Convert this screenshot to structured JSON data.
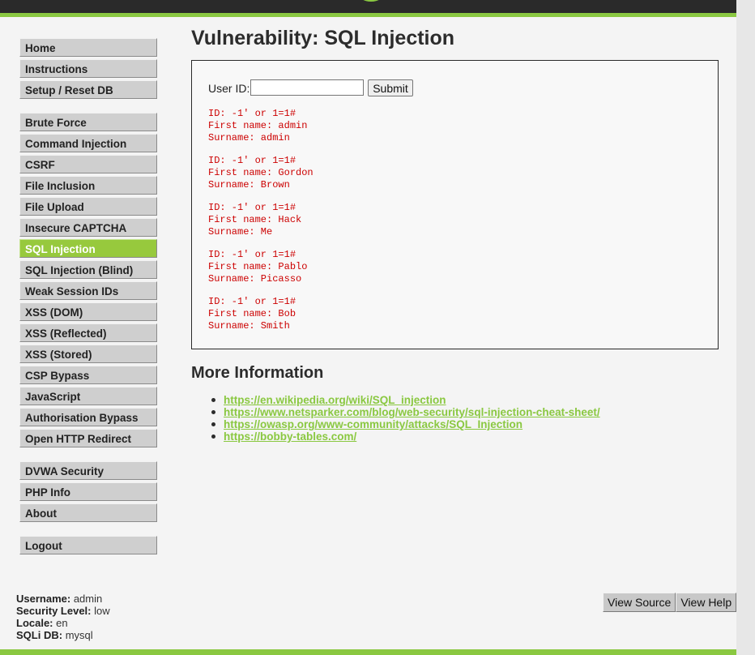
{
  "page": {
    "title": "Vulnerability: SQL Injection"
  },
  "menu": {
    "groups": [
      [
        {
          "label": "Home"
        },
        {
          "label": "Instructions"
        },
        {
          "label": "Setup / Reset DB"
        }
      ],
      [
        {
          "label": "Brute Force"
        },
        {
          "label": "Command Injection"
        },
        {
          "label": "CSRF"
        },
        {
          "label": "File Inclusion"
        },
        {
          "label": "File Upload"
        },
        {
          "label": "Insecure CAPTCHA"
        },
        {
          "label": "SQL Injection",
          "selected": true
        },
        {
          "label": "SQL Injection (Blind)"
        },
        {
          "label": "Weak Session IDs"
        },
        {
          "label": "XSS (DOM)"
        },
        {
          "label": "XSS (Reflected)"
        },
        {
          "label": "XSS (Stored)"
        },
        {
          "label": "CSP Bypass"
        },
        {
          "label": "JavaScript"
        },
        {
          "label": "Authorisation Bypass"
        },
        {
          "label": "Open HTTP Redirect"
        }
      ],
      [
        {
          "label": "DVWA Security"
        },
        {
          "label": "PHP Info"
        },
        {
          "label": "About"
        }
      ],
      [
        {
          "label": "Logout"
        }
      ]
    ]
  },
  "form": {
    "user_id_label": "User ID:",
    "user_id_value": "",
    "submit_label": "Submit"
  },
  "results": [
    {
      "id": "ID: -1' or 1=1#",
      "first_name": "First name: admin",
      "surname": "Surname: admin"
    },
    {
      "id": "ID: -1' or 1=1#",
      "first_name": "First name: Gordon",
      "surname": "Surname: Brown"
    },
    {
      "id": "ID: -1' or 1=1#",
      "first_name": "First name: Hack",
      "surname": "Surname: Me"
    },
    {
      "id": "ID: -1' or 1=1#",
      "first_name": "First name: Pablo",
      "surname": "Surname: Picasso"
    },
    {
      "id": "ID: -1' or 1=1#",
      "first_name": "First name: Bob",
      "surname": "Surname: Smith"
    }
  ],
  "more_info": {
    "title": "More Information",
    "links": [
      "https://en.wikipedia.org/wiki/SQL_injection",
      "https://www.netsparker.com/blog/web-security/sql-injection-cheat-sheet/",
      "https://owasp.org/www-community/attacks/SQL_Injection",
      "https://bobby-tables.com/"
    ]
  },
  "footer": {
    "username_label": "Username:",
    "username": "admin",
    "security_label": "Security Level:",
    "security": "low",
    "locale_label": "Locale:",
    "locale": "en",
    "sqli_db_label": "SQLi DB:",
    "sqli_db": "mysql",
    "view_source_label": "View Source",
    "view_help_label": "View Help"
  },
  "colors": {
    "accent": "#8ac841",
    "selected_menu": "#97c93d",
    "result_text": "#cc0000",
    "header_bg": "#2a2a2a"
  },
  "icons": {
    "header_logo": "dvwa-logo-swoosh"
  }
}
